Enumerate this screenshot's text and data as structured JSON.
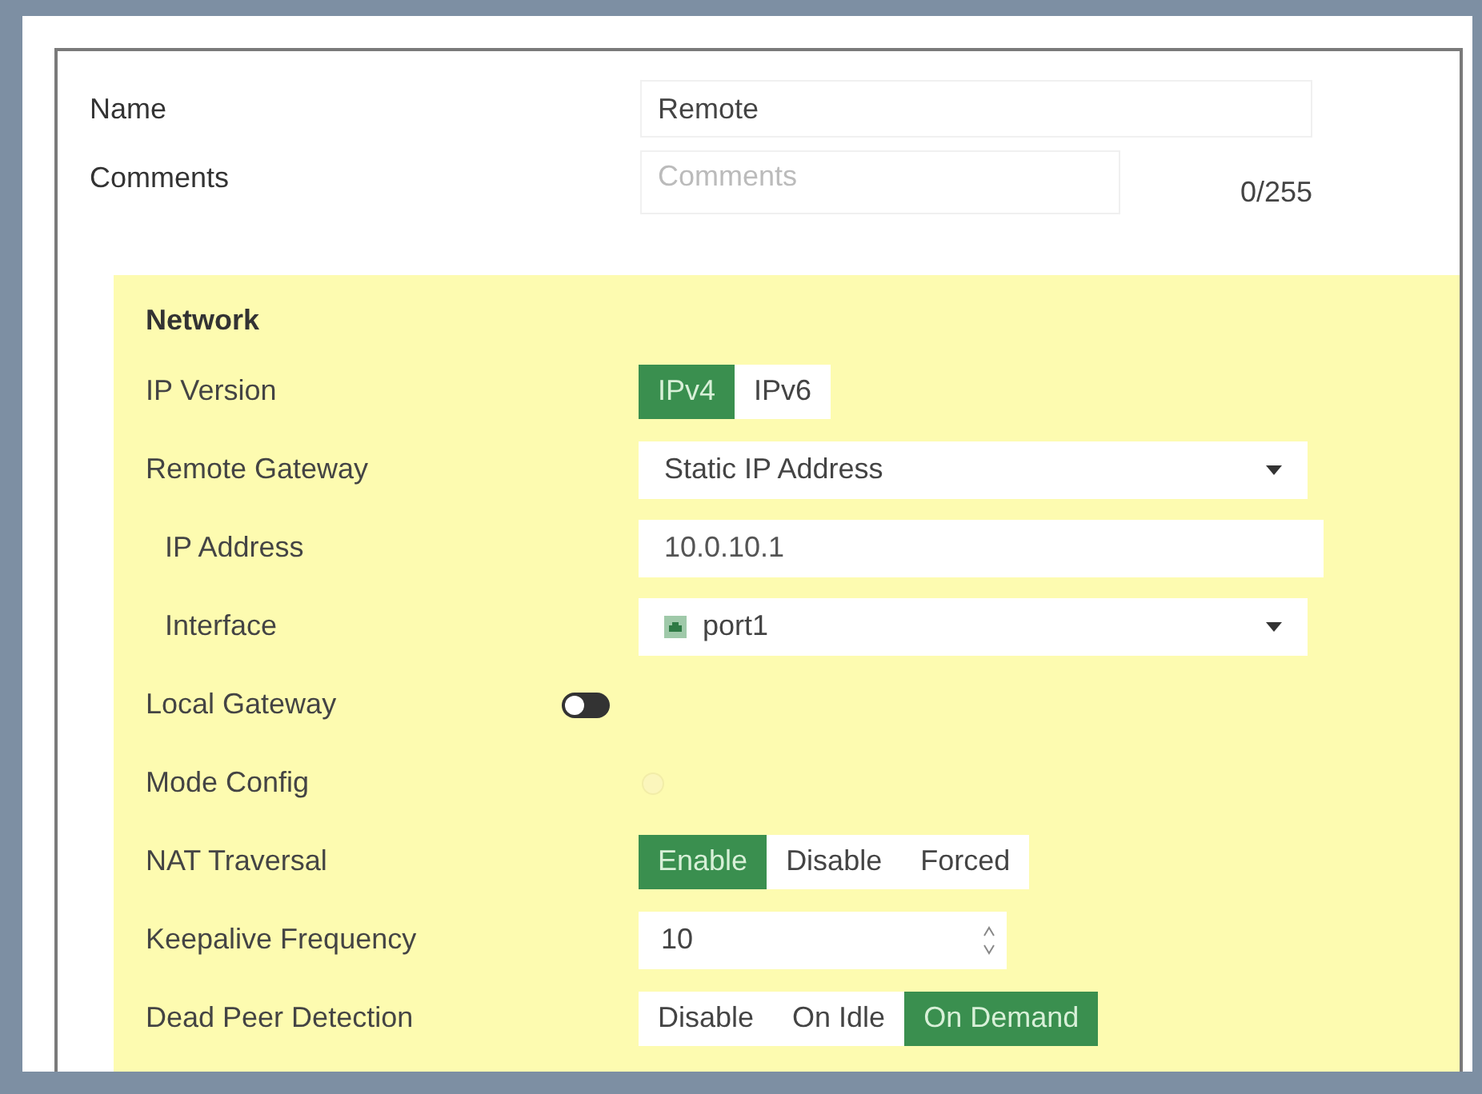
{
  "name": {
    "label": "Name",
    "value": "Remote"
  },
  "comments": {
    "label": "Comments",
    "placeholder": "Comments",
    "counter": "0/255"
  },
  "network": {
    "title": "Network",
    "rows": [
      {
        "kind": "segmented",
        "label": "IP Version",
        "options": [
          {
            "label": "IPv4",
            "selected": true
          },
          {
            "label": "IPv6",
            "selected": false
          }
        ]
      },
      {
        "kind": "select",
        "label": "Remote Gateway",
        "value": "Static IP Address",
        "children": [
          {
            "kind": "input",
            "label": "IP Address",
            "value": "10.0.10.1"
          },
          {
            "kind": "select",
            "label": "Interface",
            "value": "port1",
            "icon": true
          }
        ]
      },
      {
        "kind": "toggle",
        "label": "Local Gateway",
        "on": false
      },
      {
        "kind": "checkbox",
        "label": "Mode Config",
        "checked": false
      },
      {
        "kind": "segmented",
        "label": "NAT Traversal",
        "options": [
          {
            "label": "Enable",
            "selected": true
          },
          {
            "label": "Disable",
            "selected": false
          },
          {
            "label": "Forced",
            "selected": false
          }
        ]
      },
      {
        "kind": "spinner",
        "label": "Keepalive Frequency",
        "value": "10"
      },
      {
        "kind": "segmented",
        "label": "Dead Peer Detection",
        "options": [
          {
            "label": "Disable",
            "selected": false
          },
          {
            "label": "On Idle",
            "selected": false
          },
          {
            "label": "On Demand",
            "selected": true
          }
        ]
      }
    ]
  }
}
